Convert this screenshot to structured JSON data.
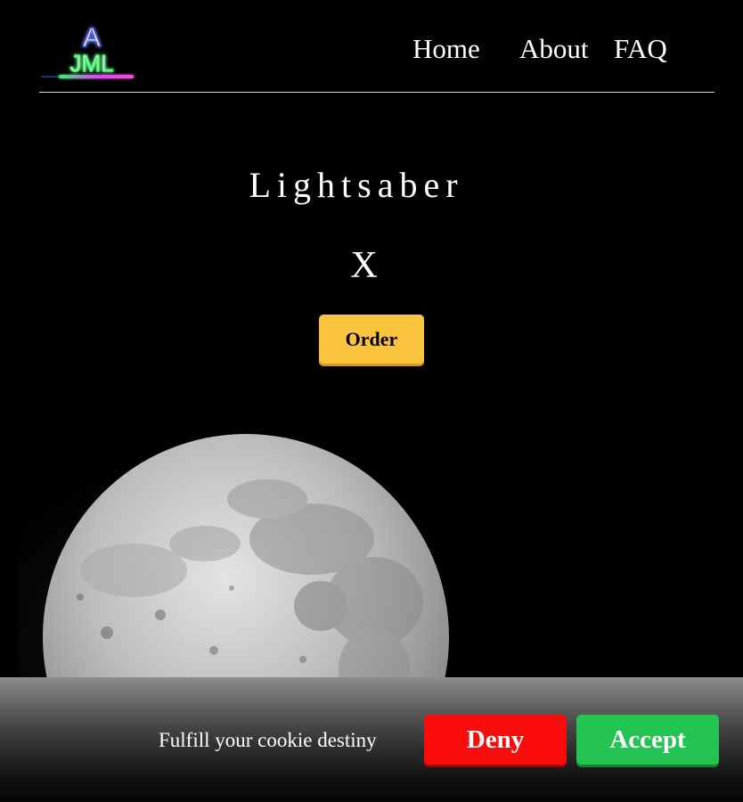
{
  "header": {
    "logo_text_top": "A",
    "logo_text_bottom": "JML",
    "nav": [
      {
        "label": "Home"
      },
      {
        "label": "About"
      },
      {
        "label": "FAQ"
      }
    ]
  },
  "hero": {
    "title": "Lightsaber",
    "subtitle": "X",
    "order_label": "Order"
  },
  "cookie_banner": {
    "message": "Fulfill your cookie destiny",
    "deny_label": "Deny",
    "accept_label": "Accept"
  },
  "colors": {
    "background": "#000000",
    "order_button": "#fbc43e",
    "deny_button": "#fb0c0c",
    "accept_button": "#24c453"
  }
}
